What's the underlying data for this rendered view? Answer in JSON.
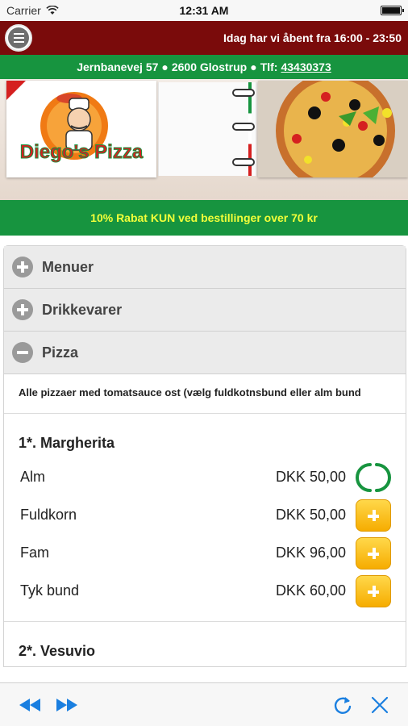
{
  "status_bar": {
    "carrier": "Carrier",
    "time": "12:31 AM"
  },
  "header": {
    "hours_text": "Idag har vi åbent fra 16:00 - 23:50"
  },
  "address": {
    "street": "Jernbanevej 57",
    "city": "2600 Glostrup",
    "phone_label": "Tlf:",
    "phone": "43430373",
    "separator": "●"
  },
  "banner": {
    "logo_text": "Diego's Pizza"
  },
  "promo": {
    "text": "10% Rabat KUN ved bestillinger over 70 kr"
  },
  "categories": [
    {
      "label": "Menuer",
      "expanded": false
    },
    {
      "label": "Drikkevarer",
      "expanded": false
    },
    {
      "label": "Pizza",
      "expanded": true
    }
  ],
  "pizza_section": {
    "description": "Alle pizzaer med tomatsauce ost (vælg fuldkotnsbund eller alm bund",
    "items": [
      {
        "title": "1*. Margherita",
        "sizes": [
          {
            "name": "Alm",
            "price": "DKK 50,00",
            "state": "loading"
          },
          {
            "name": "Fuldkorn",
            "price": "DKK 50,00",
            "state": "add"
          },
          {
            "name": "Fam",
            "price": "DKK 96,00",
            "state": "add"
          },
          {
            "name": "Tyk bund",
            "price": "DKK 60,00",
            "state": "add"
          }
        ]
      },
      {
        "title": "2*. Vesuvio"
      }
    ]
  },
  "colors": {
    "header_red": "#7a0b0b",
    "brand_green": "#17943f",
    "promo_yellow": "#f2ff3a",
    "add_orange": "#f6ac00",
    "toolbar_blue": "#1a7fe0"
  }
}
